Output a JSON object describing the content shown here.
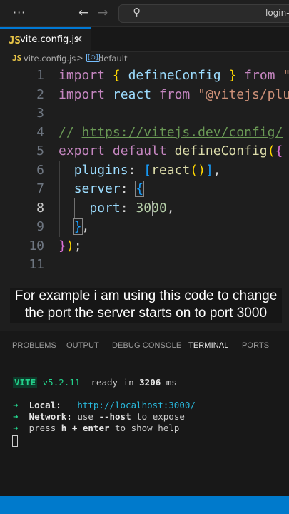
{
  "titlebar": {
    "menu_label": "···",
    "back_icon": "←",
    "forward_icon": "→",
    "search_icon": "⚲",
    "command_center_text": "login-"
  },
  "tabs": [
    {
      "icon": "JS",
      "label": "vite.config.js",
      "close": "✕",
      "active": true
    }
  ],
  "breadcrumb": {
    "file_icon": "JS",
    "file": "vite.config.js",
    "separator": ">",
    "symbol_icon": "[⊙]",
    "symbol": "default"
  },
  "editor": {
    "line_numbers": [
      "1",
      "2",
      "3",
      "4",
      "5",
      "6",
      "7",
      "8",
      "9",
      "10",
      "11"
    ],
    "active_line": "8",
    "lines": [
      "import { defineConfig } from \"vite\";",
      "import react from \"@vitejs/plugin-react\";",
      "",
      "// https://vitejs.dev/config/",
      "export default defineConfig({",
      "  plugins: [react()],",
      "  server: {",
      "    port: 3000,",
      "  },",
      "});",
      ""
    ],
    "tokens": {
      "import": "import",
      "brace_open": "{",
      "brace_close": "}",
      "defineConfig": "defineConfig",
      "from": "from",
      "str_vite": "\"vite\";",
      "react": "react",
      "str_plugin": "\"@vitejs/plugin-react\";",
      "comment_prefix": "// ",
      "comment_url": "https://vitejs.dev/config/",
      "export": "export",
      "default": "default",
      "paren_open": "(",
      "paren_close": ")",
      "plugins": "plugins",
      "colon": ":",
      "bracket_open": "[",
      "bracket_close": "]",
      "comma": ",",
      "server": "server",
      "port": "port",
      "port_head": "30",
      "port_tail": "0",
      "semicolon": ";"
    }
  },
  "caption": {
    "line1": "For example i am using this code to change",
    "line2": "the port the server starts on to port 3000"
  },
  "panel": {
    "tabs": [
      {
        "label": "PROBLEMS",
        "active": false
      },
      {
        "label": "OUTPUT",
        "active": false
      },
      {
        "label": "DEBUG CONSOLE",
        "active": false
      },
      {
        "label": "TERMINAL",
        "active": true
      },
      {
        "label": "PORTS",
        "active": false
      }
    ],
    "terminal": {
      "vite_label": "VITE",
      "version": "v5.2.11",
      "ready_text": "ready in",
      "ready_ms": "3206",
      "ms_unit": "ms",
      "arrow": "➜",
      "local_label": "Local:",
      "local_url": "http://localhost:3000/",
      "network_label": "Network:",
      "network_text_1": "use",
      "network_flag": "--host",
      "network_text_2": "to expose",
      "help_text_1": "press",
      "help_key": "h + enter",
      "help_text_2": "to show help"
    }
  },
  "colors": {
    "accent": "#0078d4",
    "statusbar": "#007acc",
    "editor_bg": "#1e1e1e"
  }
}
